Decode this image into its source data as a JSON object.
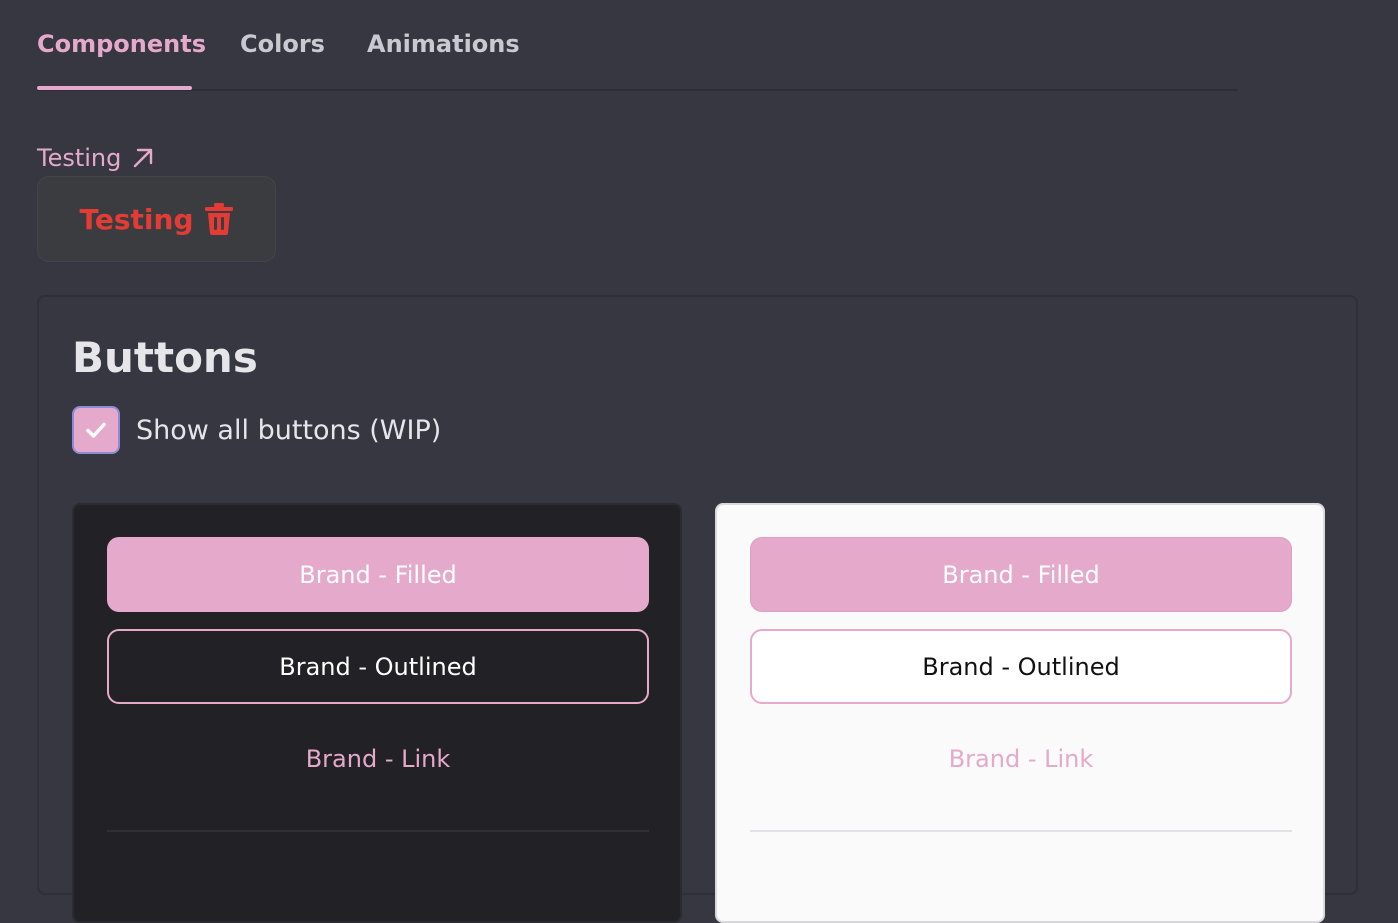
{
  "tabs": [
    {
      "label": "Components",
      "active": true
    },
    {
      "label": "Colors",
      "active": false
    },
    {
      "label": "Animations",
      "active": false
    }
  ],
  "link": {
    "label": "Testing",
    "icon": "arrow-up-right-icon"
  },
  "danger_button": {
    "label": "Testing",
    "icon": "trash-icon"
  },
  "panel": {
    "title": "Buttons",
    "checkbox": {
      "label": "Show all buttons (WIP)",
      "checked": true
    },
    "dark_demo": {
      "filled": "Brand - Filled",
      "outlined": "Brand - Outlined",
      "link": "Brand - Link"
    },
    "light_demo": {
      "filled": "Brand - Filled",
      "outlined": "Brand - Outlined",
      "link": "Brand - Link"
    }
  },
  "colors": {
    "background": "#363740",
    "brand": "#e5a9cb",
    "danger": "#e53b35",
    "dark_surface": "#212126",
    "light_surface": "#fafafa"
  }
}
